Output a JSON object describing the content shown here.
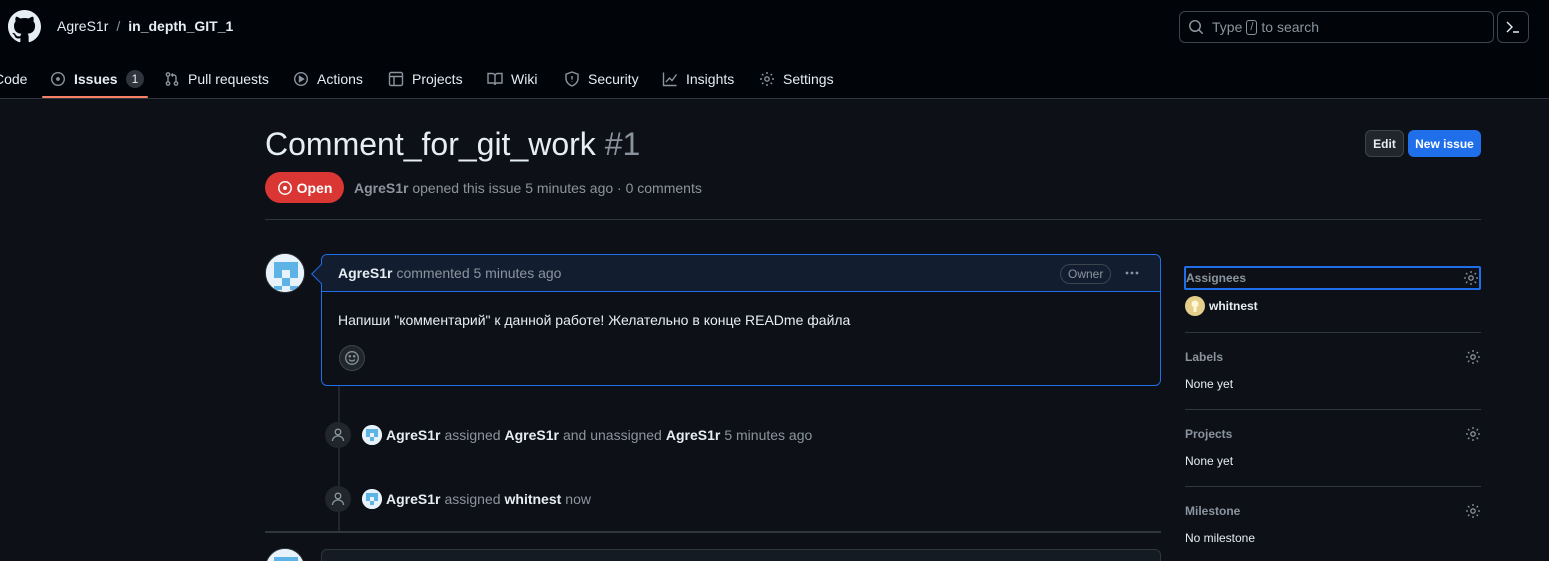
{
  "header": {
    "owner": "AgreS1r",
    "separator": "/",
    "repo": "in_depth_GIT_1",
    "search_prefix": "Type",
    "search_key": "/",
    "search_suffix": "to search"
  },
  "nav": {
    "code": "Code",
    "issues": "Issues",
    "issues_count": "1",
    "pull_requests": "Pull requests",
    "actions": "Actions",
    "projects": "Projects",
    "wiki": "Wiki",
    "security": "Security",
    "insights": "Insights",
    "settings": "Settings"
  },
  "issue": {
    "title": "Comment_for_git_work",
    "number": "#1",
    "edit_label": "Edit",
    "new_issue_label": "New issue",
    "state": "Open",
    "author": "AgreS1r",
    "meta_text": "opened this issue 5 minutes ago · 0 comments"
  },
  "comment": {
    "author": "AgreS1r",
    "action": "commented 5 minutes ago",
    "badge": "Owner",
    "body": "Напиши \"комментарий\" к данной работе! Желательно в конце READme файла"
  },
  "events": [
    {
      "actor": "AgreS1r",
      "verb1": "assigned",
      "target1": "AgreS1r",
      "verb2": "and unassigned",
      "target2": "AgreS1r",
      "time": "5 minutes ago"
    },
    {
      "actor": "AgreS1r",
      "verb1": "assigned",
      "target1": "whitnest",
      "time": "now"
    }
  ],
  "sidebar": {
    "assignees_label": "Assignees",
    "assignee": "whitnest",
    "labels_label": "Labels",
    "labels_value": "None yet",
    "projects_label": "Projects",
    "projects_value": "None yet",
    "milestone_label": "Milestone",
    "milestone_value": "No milestone"
  },
  "colors": {
    "background": "#0d1117",
    "header_bg": "#010409",
    "accent_blue": "#1f6feb",
    "open_red": "#da3633",
    "tab_underline": "#f78166"
  },
  "icons": [
    "github-logo-icon",
    "search-icon",
    "terminal-icon",
    "issue-opened-icon",
    "pull-request-icon",
    "play-icon",
    "table-icon",
    "book-icon",
    "shield-icon",
    "graph-icon",
    "gear-icon",
    "kebab-icon",
    "smiley-icon",
    "person-icon"
  ]
}
